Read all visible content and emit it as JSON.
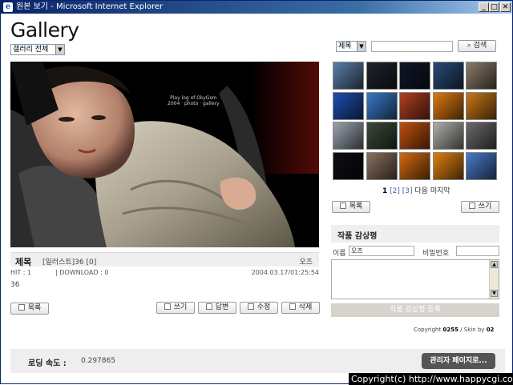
{
  "window": {
    "title": "원본 보기 - Microsoft Internet Explorer",
    "controls": [
      "_",
      "□",
      "✕"
    ]
  },
  "logo": "Gallery",
  "category_select": {
    "value": "갤러리 전체"
  },
  "photo": {
    "caption_line1": "Play log of OkyGsm",
    "caption_line2": "2004 · photo · gallery",
    "colors": {
      "bg": "#000000",
      "skin": "#c9a08a",
      "jacket": "#bdb5a2",
      "seat": "#3a3a3a"
    }
  },
  "post": {
    "title_label": "제목",
    "title_value": "[일러스트]36 [0]",
    "author": "오즈",
    "hit": "HIT : 1",
    "download": "| DOWNLOAD : 0",
    "date": "2004.03.17/01:25:54",
    "body": "36"
  },
  "buttons": {
    "list": "목록",
    "write": "쓰기",
    "reply": "답변",
    "edit": "수정",
    "delete": "삭제",
    "search": "검색",
    "submit_comment": "작품 감상평 등록",
    "admin": "관리자 페이지로..."
  },
  "search": {
    "field": "제목",
    "value": ""
  },
  "thumbnails": [
    "#5a7fa8",
    "#20242e",
    "#101828",
    "#2a4a78",
    "#8a7a6a",
    "#1e4fb0",
    "#3a7ac8",
    "#b04020",
    "#e07a10",
    "#c87818",
    "#9aa4b0",
    "#3a4a3a",
    "#c05010",
    "#b0b0a8",
    "#6a6a6a",
    "#0e0e14",
    "#8a7060",
    "#d06a10",
    "#e08010",
    "#4a7ac8"
  ],
  "pager": {
    "current": "1",
    "pages": [
      "[2]",
      "[3]"
    ],
    "next": "다음",
    "last": "마지막"
  },
  "comment": {
    "heading": "작품 감상평",
    "name_label": "이름",
    "name_value": "오즈",
    "password_label": "비밀번호"
  },
  "footer": {
    "copyright_prefix": "Copyright",
    "copyright_brand": "0255",
    "skin_text": "/ Skin by",
    "skin_author": "02",
    "loading_label": "로딩 속도 :",
    "loading_value": "0.297865",
    "watermark": "Copyright(c) http://www.happycgi.com"
  }
}
